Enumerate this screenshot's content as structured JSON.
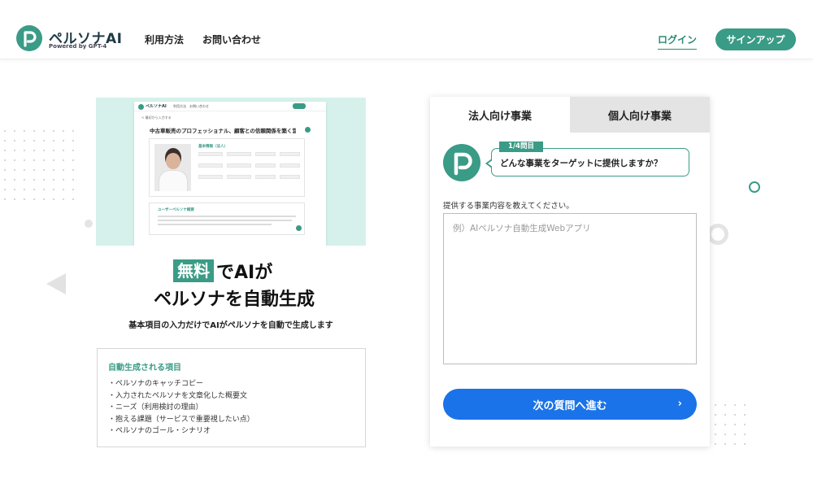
{
  "header": {
    "logo_name": "ペルソナAI",
    "logo_sub": "Powered by GPT-4",
    "nav": [
      "利用方法",
      "お問い合わせ"
    ],
    "login": "ログイン",
    "signup": "サインアップ"
  },
  "preview": {
    "logo_text": "ペルソナAI",
    "nav": [
      "利用方法",
      "お問い合わせ"
    ],
    "back": "< 最初から入力する",
    "heading": "中古車販売のプロフェッショナル、顧客との信頼関係を築く営業マン",
    "card_title": "基本情報（法人）",
    "card2_title": "ユーザーペルソナ概要"
  },
  "hero": {
    "free_badge": "無料",
    "line1_rest": "でAIが",
    "line2": "ペルソナを自動生成",
    "subtitle": "基本項目の入力だけでAIがペルソナを自動で生成します"
  },
  "generated_items": {
    "title": "自動生成される項目",
    "items": [
      "・ペルソナのキャッチコピー",
      "・入力されたペルソナを文章化した概要文",
      "・ニーズ（利用検討の理由）",
      "・抱える課題（サービスで重要視したい点）",
      "・ペルソナのゴール・シナリオ"
    ]
  },
  "form": {
    "tabs": [
      "法人向け事業",
      "個人向け事業"
    ],
    "active_tab": "法人向け事業",
    "question_count": "1/4問目",
    "question": "どんな事業をターゲットに提供しますか？",
    "field_label": "提供する事業内容を教えてください。",
    "placeholder": "例）AIペルソナ自動生成Webアプリ",
    "value": "",
    "next_button": "次の質問へ進む",
    "next_chevron": "›"
  },
  "colors": {
    "brand_green": "#3a9b86",
    "primary_blue": "#1a73e8",
    "preview_bg": "#d6f1eb",
    "inactive_tab": "#e4e4e4"
  },
  "icons": [
    "logo-p-icon",
    "avatar-p-icon",
    "chevron-right-icon"
  ]
}
